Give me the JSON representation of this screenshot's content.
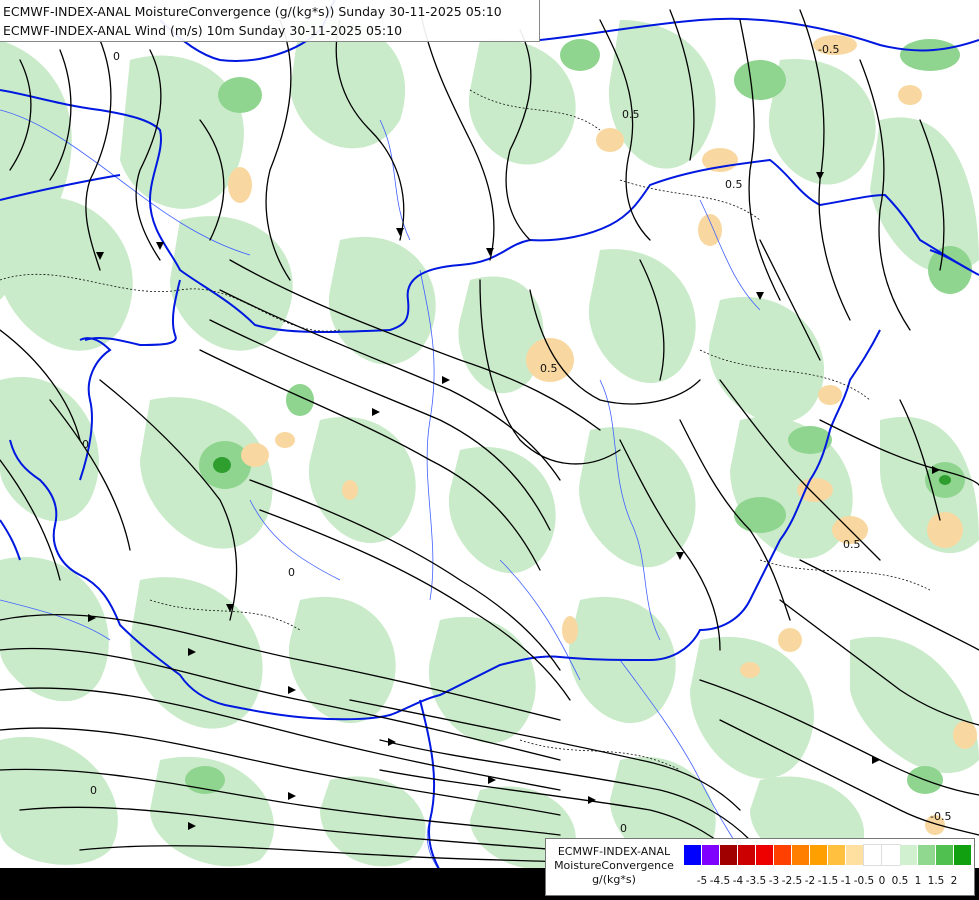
{
  "titles": {
    "line1": "ECMWF-INDEX-ANAL MoistureConvergence (g/(kg*s)) Sunday 30-11-2025 05:10",
    "line2": "ECMWF-INDEX-ANAL Wind (m/s) 10m Sunday 30-11-2025 05:10"
  },
  "legend": {
    "line1": "ECMWF-INDEX-ANAL",
    "line2": "MoistureConvergence",
    "unit": "g/(kg*s)",
    "colors": [
      "#0000ff",
      "#8000ff",
      "#a00000",
      "#cc0000",
      "#ee0000",
      "#ff4000",
      "#ff8000",
      "#ffa000",
      "#ffc040",
      "#ffe0a0",
      "#ffffff",
      "#ffffff",
      "#d0f0d0",
      "#90d890",
      "#50c050",
      "#10a010"
    ],
    "ticks": [
      "-5",
      "-4.5",
      "-4",
      "-3.5",
      "-3",
      "-2.5",
      "-2",
      "-1.5",
      "-1",
      "-0.5",
      "0",
      "0.5",
      "1",
      "1.5",
      "2"
    ]
  },
  "contour_labels": [
    "0",
    "0.5",
    "-0.5",
    "0.5",
    "0",
    "0.5",
    "-0.5",
    "0",
    "0.5",
    "0",
    "0"
  ],
  "colors": {
    "background": "#ffffff",
    "green_light": "#c9ebc9",
    "green_mid": "#8fd48f",
    "green_dark": "#2e9e2e",
    "orange_light": "#f8d8a0",
    "border": "#0018e0",
    "river": "#4060ff",
    "streamline": "#000000"
  }
}
